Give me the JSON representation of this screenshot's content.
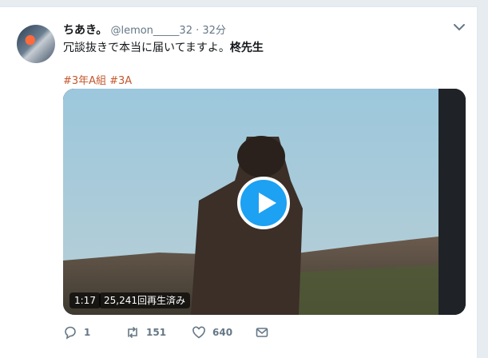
{
  "tweet": {
    "display_name": "ちあき。",
    "handle": "@lemon_____32",
    "separator": "·",
    "time": "32分",
    "text": "冗談抜きで本当に届いてますよ。",
    "text_bold": "柊先生",
    "hashtags": [
      "#3年A組",
      "#3A"
    ]
  },
  "video": {
    "duration": "1:17",
    "views": "25,241回再生済み"
  },
  "actions": {
    "reply_count": "1",
    "retweet_count": "151",
    "like_count": "640"
  },
  "icons": [
    "chevron-down-icon",
    "reply-icon",
    "retweet-icon",
    "heart-icon",
    "mail-icon",
    "play-icon"
  ],
  "colors": {
    "accent": "#1da1f2",
    "hashtag": "#c3572c",
    "meta": "#657786"
  }
}
